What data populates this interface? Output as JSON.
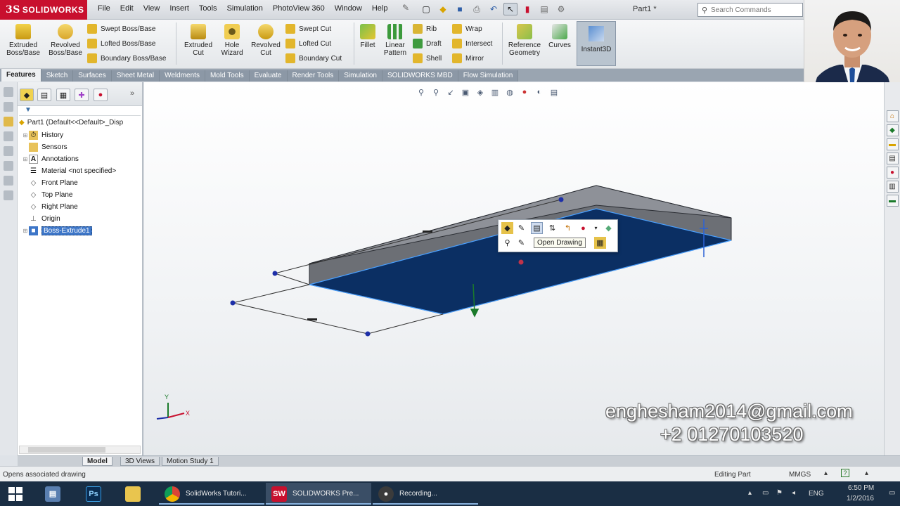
{
  "app": {
    "logo_text": "SOLIDWORKS",
    "document_title": "Part1 *",
    "search_placeholder": "Search Commands",
    "menu": [
      "File",
      "Edit",
      "View",
      "Insert",
      "Tools",
      "Simulation",
      "PhotoView 360",
      "Window",
      "Help"
    ]
  },
  "ribbon": {
    "extruded_boss": "Extruded Boss/Base",
    "revolved_boss": "Revolved Boss/Base",
    "swept_boss": "Swept Boss/Base",
    "lofted_boss": "Lofted Boss/Base",
    "boundary_boss": "Boundary Boss/Base",
    "extruded_cut": "Extruded Cut",
    "hole_wizard": "Hole Wizard",
    "revolved_cut": "Revolved Cut",
    "swept_cut": "Swept Cut",
    "lofted_cut": "Lofted Cut",
    "boundary_cut": "Boundary Cut",
    "fillet": "Fillet",
    "linear_pattern": "Linear Pattern",
    "rib": "Rib",
    "draft": "Draft",
    "shell": "Shell",
    "wrap": "Wrap",
    "intersect": "Intersect",
    "mirror": "Mirror",
    "reference_geometry": "Reference Geometry",
    "curves": "Curves",
    "instant3d": "Instant3D"
  },
  "tabs": [
    "Features",
    "Sketch",
    "Surfaces",
    "Sheet Metal",
    "Weldments",
    "Mold Tools",
    "Evaluate",
    "Render Tools",
    "Simulation",
    "SOLIDWORKS MBD",
    "Flow Simulation"
  ],
  "active_tab": "Features",
  "tree": {
    "root": "Part1  (Default<<Default>_Disp",
    "items": [
      {
        "label": "History",
        "icon": "history-icon"
      },
      {
        "label": "Sensors",
        "icon": "sensors-icon"
      },
      {
        "label": "Annotations",
        "icon": "annotations-icon"
      },
      {
        "label": "Material <not specified>",
        "icon": "material-icon"
      },
      {
        "label": "Front Plane",
        "icon": "plane-icon"
      },
      {
        "label": "Top Plane",
        "icon": "plane-icon"
      },
      {
        "label": "Right Plane",
        "icon": "plane-icon"
      },
      {
        "label": "Origin",
        "icon": "origin-icon"
      },
      {
        "label": "Boss-Extrude1",
        "icon": "extrude-icon"
      }
    ]
  },
  "tooltip": "Open Drawing",
  "overlay": {
    "email": "enghesham2014@gmail.com",
    "phone": "+2 01270103520"
  },
  "triad": {
    "y": "Y",
    "x": "X"
  },
  "bottom_tabs": [
    "Model",
    "3D Views",
    "Motion Study 1"
  ],
  "status": {
    "message": "Opens associated drawing",
    "mode": "Editing Part",
    "units": "MMGS"
  },
  "taskbar": {
    "apps": [
      {
        "label": "SolidWorks Tutori...",
        "icon": "chrome-icon"
      },
      {
        "label": "SOLIDWORKS Pre...",
        "icon": "solidworks-icon"
      },
      {
        "label": "Recording...",
        "icon": "recording-icon"
      }
    ],
    "language": "ENG",
    "time": "6:50 PM",
    "date": "1/2/2016"
  },
  "colors": {
    "brand_red": "#c8102e",
    "face_blue": "#0b2f63",
    "edge_blue": "#4aa0ff",
    "selection": "#3d76c8"
  }
}
